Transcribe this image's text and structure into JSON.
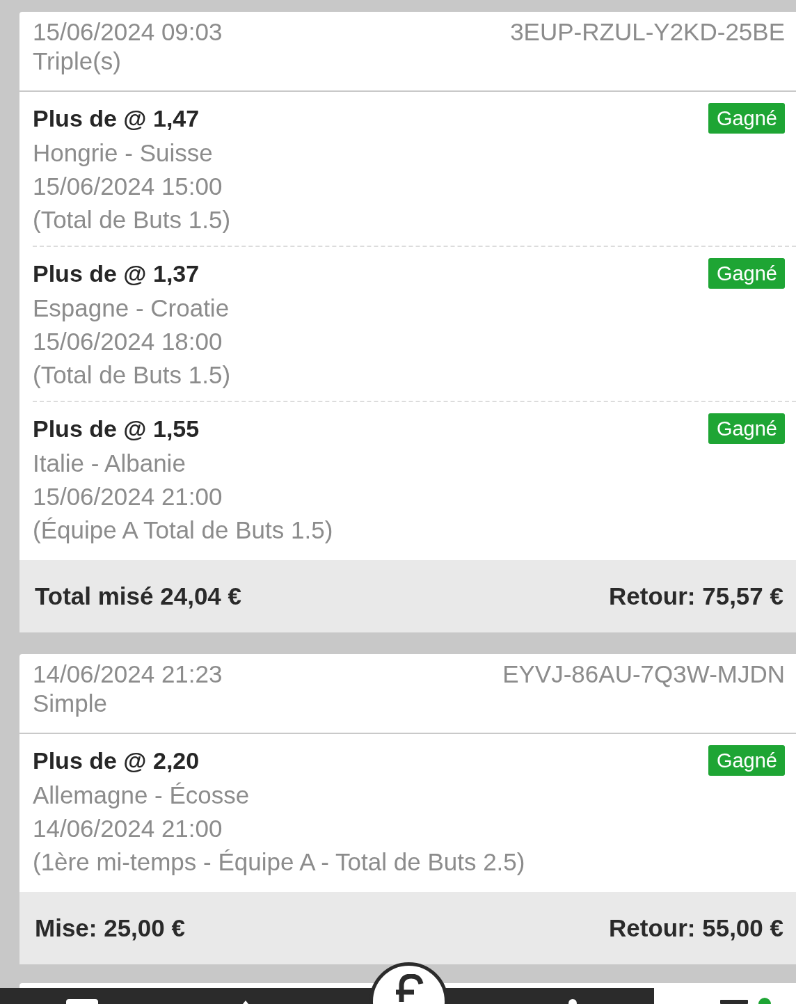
{
  "bets": [
    {
      "placed": "15/06/2024 09:03",
      "reference": "3EUP-RZUL-Y2KD-25BE",
      "type": "Triple(s)",
      "selections": [
        {
          "title": "Plus de @ 1,47",
          "match": "Hongrie - Suisse",
          "kickoff": "15/06/2024 15:00",
          "market": "(Total de Buts 1.5)",
          "status": "Gagné"
        },
        {
          "title": "Plus de @ 1,37",
          "match": "Espagne - Croatie",
          "kickoff": "15/06/2024 18:00",
          "market": "(Total de Buts 1.5)",
          "status": "Gagné"
        },
        {
          "title": "Plus de @ 1,55",
          "match": "Italie - Albanie",
          "kickoff": "15/06/2024 21:00",
          "market": "(Équipe A Total de Buts 1.5)",
          "status": "Gagné"
        }
      ],
      "stake": "Total misé 24,04 €",
      "return": "Retour: 75,57 €"
    },
    {
      "placed": "14/06/2024 21:23",
      "reference": "EYVJ-86AU-7Q3W-MJDN",
      "type": "Simple",
      "selections": [
        {
          "title": "Plus de @ 2,20",
          "match": "Allemagne - Écosse",
          "kickoff": "14/06/2024 21:00",
          "market": "(1ère mi-temps - Équipe A - Total de Buts 2.5)",
          "status": "Gagné"
        }
      ],
      "stake": "Mise: 25,00 €",
      "return": "Retour: 55,00 €"
    }
  ]
}
